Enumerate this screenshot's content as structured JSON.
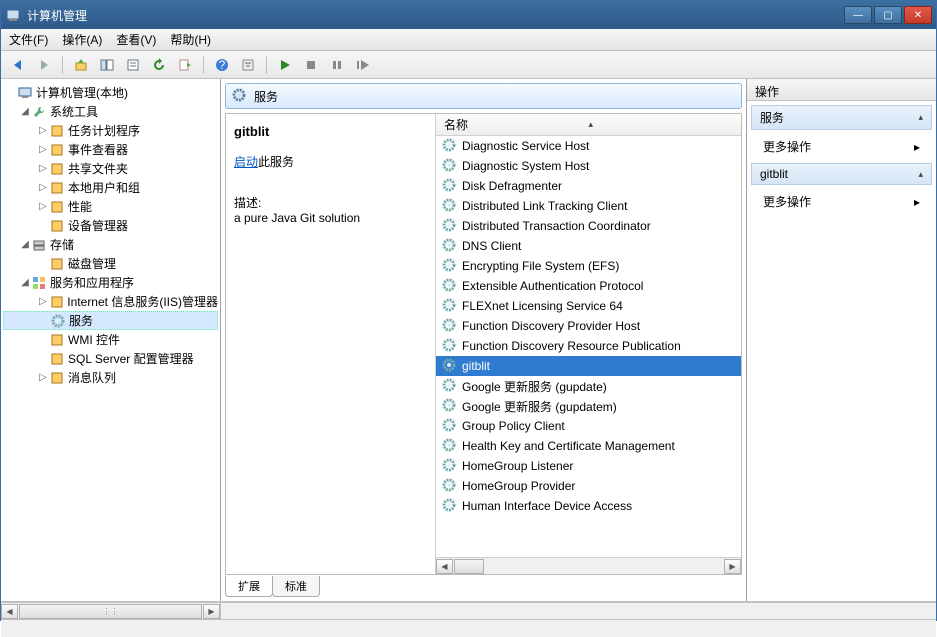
{
  "window": {
    "title": "计算机管理"
  },
  "menu": {
    "file": "文件(F)",
    "action": "操作(A)",
    "view": "查看(V)",
    "help": "帮助(H)"
  },
  "tree": {
    "root": "计算机管理(本地)",
    "g1": "系统工具",
    "g1_items": [
      "任务计划程序",
      "事件查看器",
      "共享文件夹",
      "本地用户和组",
      "性能",
      "设备管理器"
    ],
    "g2": "存储",
    "g2_items": [
      "磁盘管理"
    ],
    "g3": "服务和应用程序",
    "g3_items": [
      "Internet 信息服务(IIS)管理器",
      "服务",
      "WMI 控件",
      "SQL Server 配置管理器",
      "消息队列"
    ]
  },
  "center": {
    "header": "服务",
    "selected_name": "gitblit",
    "start_link": "启动",
    "start_suffix": "此服务",
    "desc_label": "描述:",
    "desc_value": "a pure Java Git solution",
    "col_name": "名称",
    "tabs": {
      "extended": "扩展",
      "standard": "标准"
    }
  },
  "services": [
    "Diagnostic Service Host",
    "Diagnostic System Host",
    "Disk Defragmenter",
    "Distributed Link Tracking Client",
    "Distributed Transaction Coordinator",
    "DNS Client",
    "Encrypting File System (EFS)",
    "Extensible Authentication Protocol",
    "FLEXnet Licensing Service 64",
    "Function Discovery Provider Host",
    "Function Discovery Resource Publication",
    "gitblit",
    "Google 更新服务 (gupdate)",
    "Google 更新服务 (gupdatem)",
    "Group Policy Client",
    "Health Key and Certificate Management",
    "HomeGroup Listener",
    "HomeGroup Provider",
    "Human Interface Device Access"
  ],
  "selected_service_index": 11,
  "actions": {
    "header": "操作",
    "section1": "服务",
    "more": "更多操作",
    "section2": "gitblit"
  }
}
